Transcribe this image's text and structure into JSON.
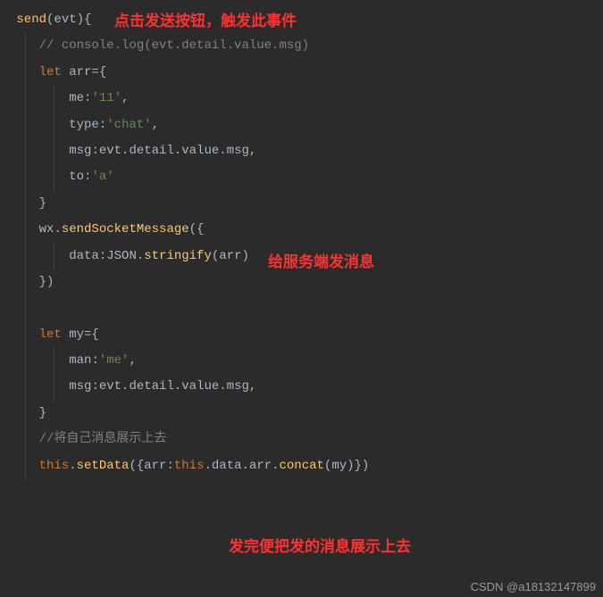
{
  "code": {
    "line1_fn": "send",
    "line1_params": "(evt){",
    "line2_comment": "// console.log(evt.detail.value.msg)",
    "line3_let": "let",
    "line3_var": " arr={",
    "line4_prop": "me",
    "line4_val": "'11'",
    "line5_prop": "type",
    "line5_val": "'chat'",
    "line6_prop": "msg",
    "line6_val": ":evt.detail.value.msg,",
    "line7_prop": "to",
    "line7_val": "'a'",
    "line8_brace": "}",
    "line9_obj": "wx",
    "line9_dot": ".",
    "line9_method": "sendSocketMessage",
    "line9_paren": "({",
    "line10_prop": "data",
    "line10_colon": ":",
    "line10_json": "JSON",
    "line10_dot": ".",
    "line10_method": "stringify",
    "line10_arg": "(arr)",
    "line11_close": "})",
    "line13_let": "let",
    "line13_var": " my={",
    "line14_prop": "man",
    "line14_val": "'me'",
    "line15_prop": "msg",
    "line15_val": ":evt.detail.value.msg,",
    "line16_brace": "}",
    "line17_comment": "//将自己消息展示上去",
    "line18_this": "this",
    "line18_dot": ".",
    "line18_method": "setData",
    "line18_open": "({",
    "line18_prop": "arr",
    "line18_colon": ":",
    "line18_this2": "this",
    "line18_rest": ".data.arr.",
    "line18_concat": "concat",
    "line18_arg": "(my)})"
  },
  "annotations": {
    "a1": "点击发送按钮，触发此事件",
    "a2": "给服务端发消息",
    "a3": "发完便把发的消息展示上去"
  },
  "watermark": "CSDN @a18132147899"
}
